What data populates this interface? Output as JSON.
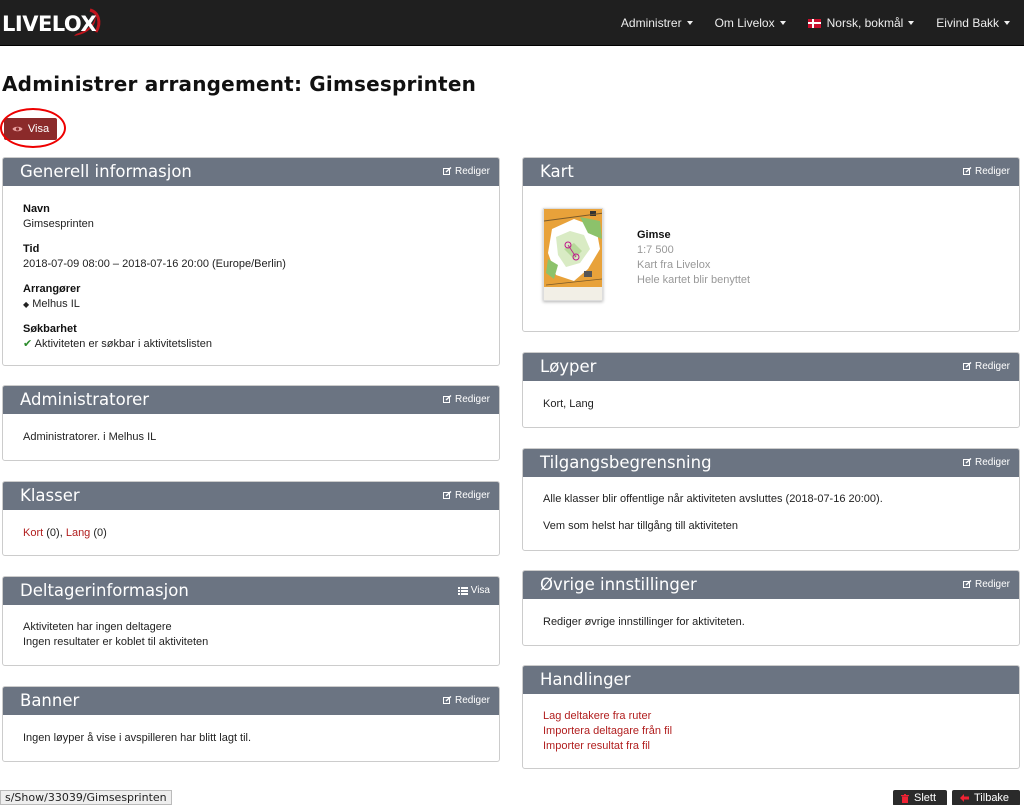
{
  "nav": {
    "logo": "LIVELOX",
    "items": [
      {
        "label": "Administrer"
      },
      {
        "label": "Om Livelox"
      },
      {
        "label": "Norsk, bokmål"
      },
      {
        "label": "Eivind Bakk"
      }
    ]
  },
  "page": {
    "title": "Administrer arrangement: Gimsesprinten",
    "visa_label": "Visa"
  },
  "edit_label": "Rediger",
  "general": {
    "title": "Generell informasjon",
    "name_label": "Navn",
    "name_value": "Gimsesprinten",
    "time_label": "Tid",
    "time_value": "2018-07-09 08:00 – 2018-07-16 20:00 (Europe/Berlin)",
    "organizers_label": "Arrangører",
    "organizers_value": "Melhus IL",
    "search_label": "Søkbarhet",
    "search_value": "Aktiviteten er søkbar i aktivitetslisten"
  },
  "administrators": {
    "title": "Administratorer",
    "text": "Administratorer. i Melhus IL"
  },
  "classes": {
    "title": "Klasser",
    "items": [
      {
        "name": "Kort",
        "count": "(0)"
      },
      {
        "name": "Lang",
        "count": "(0)"
      }
    ],
    "separator": ","
  },
  "participants": {
    "title": "Deltagerinformasjon",
    "action": "Visa",
    "line1": "Aktiviteten har ingen deltagere",
    "line2": "Ingen resultater er koblet til aktiviteten"
  },
  "banner": {
    "title": "Banner",
    "text": "Ingen løyper å vise i avspilleren har blitt lagt til."
  },
  "map": {
    "title": "Kart",
    "name": "Gimse",
    "scale": "1:7 500",
    "source": "Kart fra Livelox",
    "usage": "Hele kartet blir benyttet"
  },
  "courses": {
    "title": "Løyper",
    "text": "Kort, Lang"
  },
  "access": {
    "title": "Tilgangsbegrensning",
    "line1": "Alle klasser blir offentlige når aktiviteten avsluttes (2018-07-16 20:00).",
    "line2": "Vem som helst har tillgång till aktiviteten"
  },
  "other": {
    "title": "Øvrige innstillinger",
    "text": "Rediger øvrige innstillinger for aktiviteten."
  },
  "actions": {
    "title": "Handlinger",
    "links": [
      "Lag deltakere fra ruter",
      "Importera deltagare från fil",
      "Importer resultat fra fil"
    ]
  },
  "footer": {
    "url": "s/Show/33039/Gimsesprinten",
    "delete_label": "Slett",
    "back_label": "Tilbake"
  }
}
